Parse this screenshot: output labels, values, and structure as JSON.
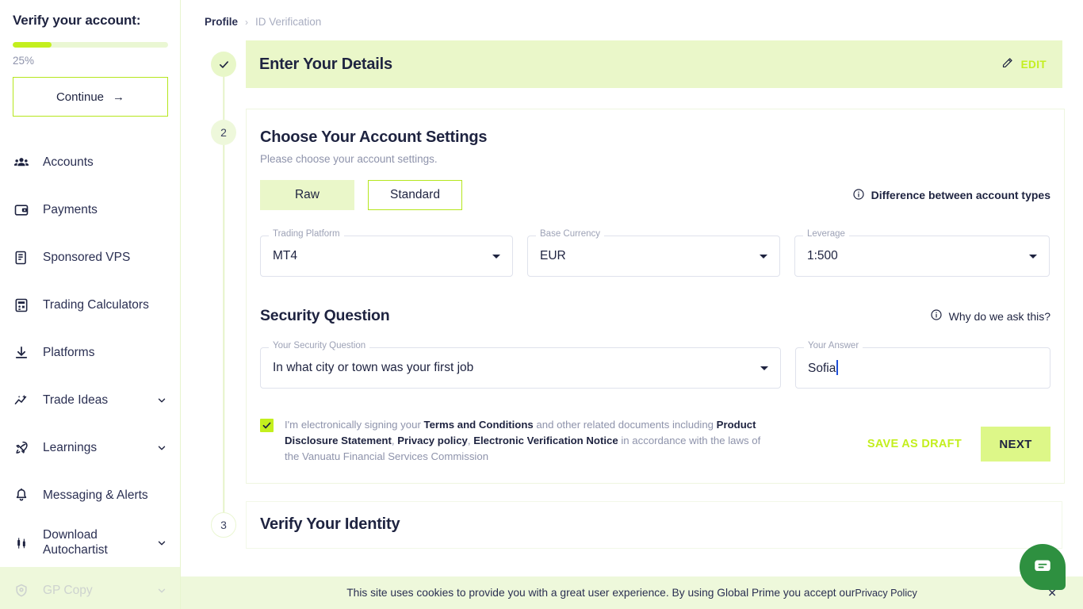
{
  "sidebar": {
    "verify_title": "Verify your account:",
    "progress_percent": "25%",
    "progress_value": 25,
    "continue_label": "Continue",
    "continue_arrow": "→",
    "items": [
      {
        "label": "Accounts",
        "icon": "people-icon",
        "chevron": false,
        "disabled": false
      },
      {
        "label": "Payments",
        "icon": "wallet-icon",
        "chevron": false,
        "disabled": false
      },
      {
        "label": "Sponsored VPS",
        "icon": "server-icon",
        "chevron": false,
        "disabled": false
      },
      {
        "label": "Trading Calculators",
        "icon": "calculator-icon",
        "chevron": false,
        "disabled": false
      },
      {
        "label": "Platforms",
        "icon": "download-icon",
        "chevron": false,
        "disabled": false
      },
      {
        "label": "Trade Ideas",
        "icon": "sparkle-chart-icon",
        "chevron": true,
        "disabled": false
      },
      {
        "label": "Learnings",
        "icon": "rocket-icon",
        "chevron": true,
        "disabled": false
      },
      {
        "label": "Messaging & Alerts",
        "icon": "bell-icon",
        "chevron": false,
        "disabled": false
      },
      {
        "label": "Download Autochartist",
        "icon": "candlestick-icon",
        "chevron": true,
        "disabled": false
      },
      {
        "label": "GP Copy",
        "icon": "badge-icon",
        "chevron": true,
        "disabled": true
      }
    ]
  },
  "breadcrumb": {
    "parent": "Profile",
    "separator": "›",
    "current": "ID Verification"
  },
  "steps": [
    {
      "marker": "✓",
      "state": "done",
      "title": "Enter Your Details",
      "edit_label": "EDIT",
      "edit_icon": "pencil-icon"
    },
    {
      "marker": "2",
      "state": "active",
      "title": "Choose Your Account Settings",
      "subtitle": "Please choose your account settings."
    },
    {
      "marker": "3",
      "state": "pending",
      "title": "Verify Your Identity"
    }
  ],
  "account_settings": {
    "account_types": [
      {
        "label": "Raw",
        "selected": true
      },
      {
        "label": "Standard",
        "selected": false
      }
    ],
    "difference_link": "Difference between account types",
    "difference_icon": "info-icon",
    "fields": [
      {
        "label": "Trading Platform",
        "value": "MT4",
        "control": "select"
      },
      {
        "label": "Base Currency",
        "value": "EUR",
        "control": "select"
      },
      {
        "label": "Leverage",
        "value": "1:500",
        "control": "select"
      }
    ]
  },
  "security_question": {
    "heading": "Security Question",
    "why_link": "Why do we ask this?",
    "why_icon": "info-icon",
    "question_label": "Your Security Question",
    "question_value": "In what city or town was your first job",
    "answer_label": "Your Answer",
    "answer_value": "Sofia"
  },
  "terms": {
    "checked": true,
    "segments": [
      {
        "text": "I'm electronically signing your ",
        "bold": false
      },
      {
        "text": "Terms and Conditions",
        "bold": true
      },
      {
        "text": " and other related documents including ",
        "bold": false
      },
      {
        "text": "Product Disclosure Statement",
        "bold": true
      },
      {
        "text": ", ",
        "bold": false
      },
      {
        "text": "Privacy policy",
        "bold": true
      },
      {
        "text": ", ",
        "bold": false
      },
      {
        "text": "Electronic Verification Notice",
        "bold": true
      },
      {
        "text": " in accordance with the laws of the Vanuatu Financial Services Commission",
        "bold": false
      }
    ]
  },
  "actions": {
    "save_draft_label": "SAVE AS DRAFT",
    "next_label": "NEXT"
  },
  "cookie_banner": {
    "text": "This site uses cookies to provide you with a great user experience. By using Global Prime you accept our ",
    "link": "Privacy Policy",
    "close_icon": "close-icon",
    "close_glyph": "✕"
  },
  "chat_widget": {
    "icon": "chat-bubble-icon"
  },
  "colors": {
    "accent_green": "#c3ef1e",
    "pale_green": "#eaf7c9",
    "banner_green": "#eef8db",
    "next_green": "#ddf788",
    "text_dark": "#1e2340",
    "text_muted": "#8e93ab",
    "chat_green": "#2e9040",
    "cursor_blue": "#1f4fd8"
  }
}
